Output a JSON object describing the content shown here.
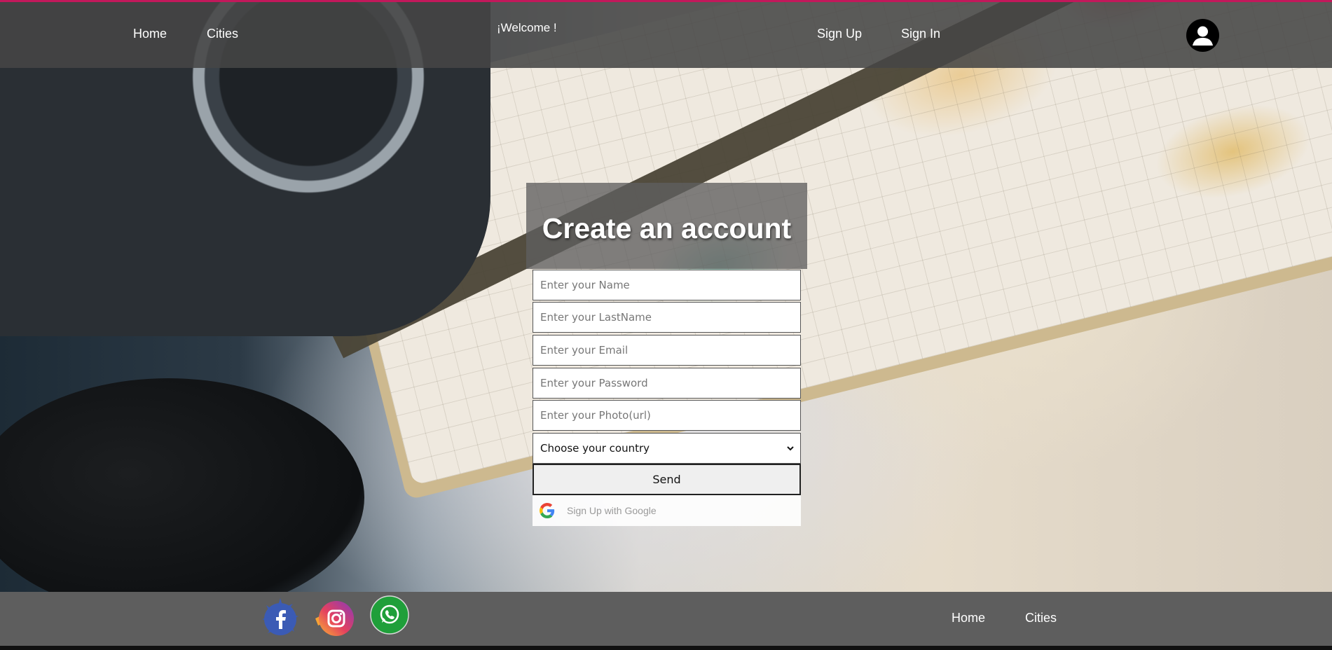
{
  "header": {
    "nav": [
      {
        "label": "Home"
      },
      {
        "label": "Cities"
      }
    ],
    "welcome": "¡Welcome !",
    "auth": [
      {
        "label": "Sign Up"
      },
      {
        "label": "Sign In"
      }
    ],
    "avatar_icon": "user-avatar-icon",
    "accent_color": "#c2185b"
  },
  "form": {
    "title": "Create an account",
    "fields": [
      {
        "placeholder": "Enter your Name",
        "value": ""
      },
      {
        "placeholder": "Enter your LastName",
        "value": ""
      },
      {
        "placeholder": "Enter your Email",
        "value": ""
      },
      {
        "placeholder": "Enter your Password",
        "value": ""
      },
      {
        "placeholder": "Enter your Photo(url)",
        "value": ""
      }
    ],
    "country_select": {
      "selected": "Choose your country"
    },
    "send_label": "Send",
    "google_label": "Sign Up with Google"
  },
  "footer": {
    "social": [
      "facebook-icon",
      "instagram-icon",
      "whatsapp-icon"
    ],
    "nav": [
      {
        "label": "Home"
      },
      {
        "label": "Cities"
      }
    ]
  }
}
